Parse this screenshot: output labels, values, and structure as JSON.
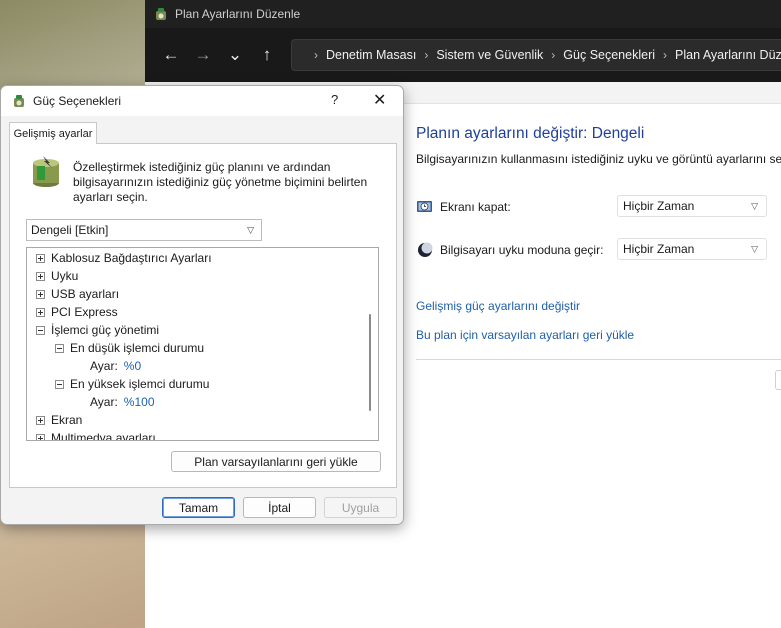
{
  "cp_window": {
    "title": "Plan Ayarlarını Düzenle",
    "nav": {
      "back": "←",
      "forward": "→",
      "recent": "⌄",
      "up": "↑"
    },
    "breadcrumb": [
      "Denetim Masası",
      "Sistem ve Güvenlik",
      "Güç Seçenekleri",
      "Plan Ayarlarını Düzenle"
    ],
    "heading": "Planın ayarlarını değiştir: Dengeli",
    "subtitle": "Bilgisayarınızın kullanmasını istediğiniz uyku ve görüntü ayarlarını seç",
    "display_off_label": "Ekranı kapat:",
    "display_off_value": "Hiçbir Zaman",
    "sleep_label": "Bilgisayarı uyku moduna geçir:",
    "sleep_value": "Hiçbir Zaman",
    "link_advanced": "Gelişmiş güç ayarlarını değiştir",
    "link_restore": "Bu plan için varsayılan ayarları geri yükle"
  },
  "dialog": {
    "title": "Güç Seçenekleri",
    "help": "?",
    "close": "✕",
    "tab": "Gelişmiş ayarlar",
    "description": "Özelleştirmek istediğiniz güç planını ve ardından bilgisayarınızın istediğiniz güç yönetme biçimini belirten ayarları seçin.",
    "plan_selected": "Dengeli [Etkin]",
    "tree": {
      "wireless": "Kablosuz Bağdaştırıcı Ayarları",
      "sleep": "Uyku",
      "usb": "USB ayarları",
      "pci": "PCI Express",
      "cpu": "İşlemci güç yönetimi",
      "min_state": "En düşük işlemci durumu",
      "min_setting_label": "Ayar:",
      "min_setting_value": "%0",
      "max_state": "En yüksek işlemci durumu",
      "max_setting_label": "Ayar:",
      "max_setting_value": "%100",
      "display": "Ekran",
      "multimedia": "Multimedya ayarları"
    },
    "restore_button": "Plan varsayılanlarını geri yükle",
    "ok_button": "Tamam",
    "cancel_button": "İptal",
    "apply_button": "Uygula"
  }
}
